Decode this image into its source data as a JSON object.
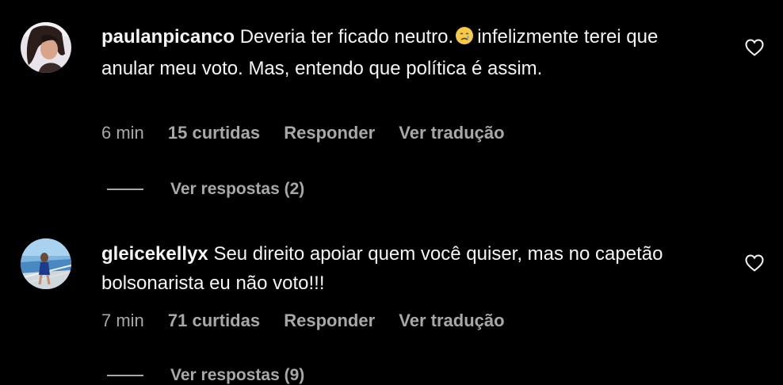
{
  "comments": [
    {
      "username": "paulanpicanco",
      "text_before_emoji": "Deveria ter ficado neutro.",
      "emoji": "crying-face-icon",
      "text_after_emoji": "infelizmente terei que anular meu voto. Mas, entendo que política é assim.",
      "time": "6 min",
      "likes": "15 curtidas",
      "reply_label": "Responder",
      "translate_label": "Ver tradução",
      "view_replies": "Ver respostas (2)"
    },
    {
      "username": "gleicekellyx",
      "text": "Seu direito apoiar quem você quiser, mas no capetão bolsonarista eu não voto!!!",
      "time": "7 min",
      "likes": "71 curtidas",
      "reply_label": "Responder",
      "translate_label": "Ver tradução",
      "view_replies": "Ver respostas (9)"
    }
  ],
  "colors": {
    "background": "#000000",
    "primary_text": "#f5f5f5",
    "secondary_text": "#a8a8a8"
  },
  "icons": {
    "like": "heart-outline-icon",
    "emoji": "crying-face-icon"
  }
}
